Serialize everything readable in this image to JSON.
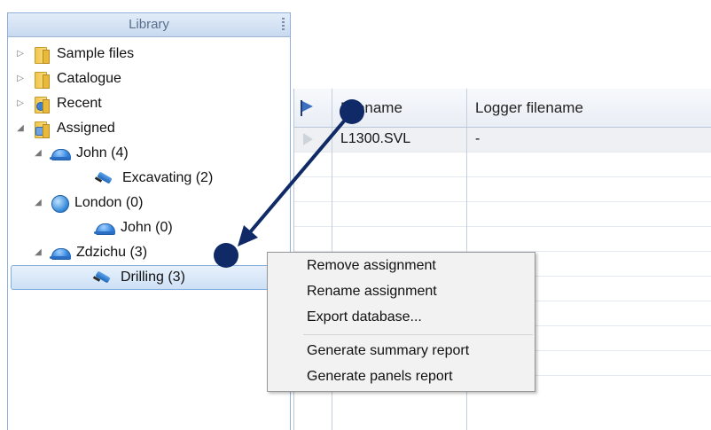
{
  "library": {
    "title": "Library",
    "items": [
      {
        "label": "Sample files",
        "icon": "folder-icon"
      },
      {
        "label": "Catalogue",
        "icon": "folder-icon"
      },
      {
        "label": "Recent",
        "icon": "recent-folder-icon"
      },
      {
        "label": "Assigned",
        "icon": "assigned-folder-icon"
      },
      {
        "label": "John (4)",
        "icon": "helmet-icon"
      },
      {
        "label": "Excavating (2)",
        "icon": "drill-icon"
      },
      {
        "label": "London (0)",
        "icon": "globe-icon"
      },
      {
        "label": "John (0)",
        "icon": "helmet-icon"
      },
      {
        "label": "Zdzichu (3)",
        "icon": "helmet-icon"
      },
      {
        "label": "Drilling (3)",
        "icon": "drill-icon",
        "selected": true
      }
    ]
  },
  "grid": {
    "columns": [
      "Filename",
      "Logger filename"
    ],
    "rows": [
      {
        "filename": "L1300.SVL",
        "logger_filename": "-"
      }
    ]
  },
  "context_menu": {
    "items": [
      "Remove assignment",
      "Rename assignment",
      "Export database...",
      "Generate summary report",
      "Generate panels report"
    ]
  },
  "colors": {
    "accent": "#0f2a66",
    "selection": "#cde0f6",
    "header": "#c8d9ef"
  }
}
